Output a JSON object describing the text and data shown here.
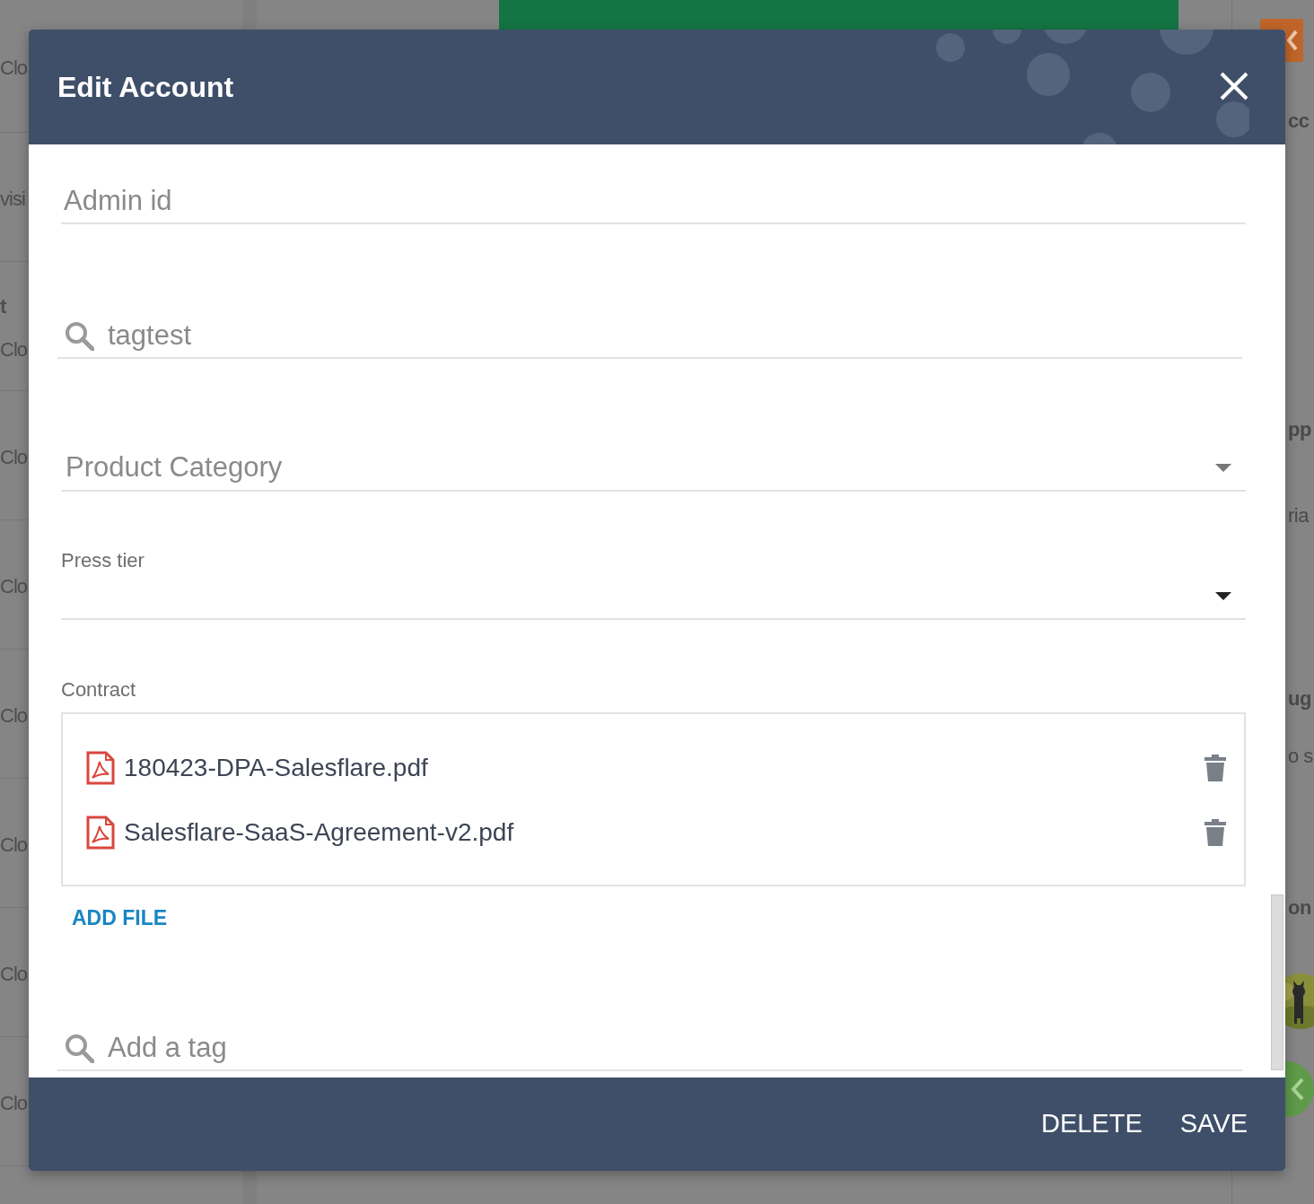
{
  "background": {
    "left_rows": [
      {
        "lines": [
          {
            "text": "Clo",
            "bold": false
          }
        ]
      },
      {
        "lines": [
          {
            "text": "visi",
            "bold": false
          }
        ]
      },
      {
        "lines": [
          {
            "text": "t",
            "bold": true
          },
          {
            "text": "Clo",
            "bold": false
          }
        ]
      },
      {
        "lines": [
          {
            "text": "Clo",
            "bold": false
          }
        ]
      },
      {
        "lines": [
          {
            "text": "Clo",
            "bold": false
          }
        ]
      },
      {
        "lines": [
          {
            "text": "Clo",
            "bold": false
          }
        ]
      },
      {
        "lines": [
          {
            "text": "Clo",
            "bold": false
          }
        ]
      },
      {
        "lines": [
          {
            "text": "Clo",
            "bold": false
          }
        ]
      },
      {
        "lines": [
          {
            "text": "Clo",
            "bold": false
          }
        ]
      }
    ],
    "right_texts": [
      {
        "text": "cc",
        "bold": true
      },
      {
        "text": "pp",
        "bold": true
      },
      {
        "text": "ria",
        "bold": false
      },
      {
        "text": "ug",
        "bold": true
      },
      {
        "text": "o s",
        "bold": false
      },
      {
        "text": "on",
        "bold": true
      }
    ]
  },
  "dialog": {
    "title": "Edit Account",
    "fields": [
      {
        "kind": "text",
        "placeholder": "Admin id"
      },
      {
        "kind": "search",
        "placeholder": "tagtest"
      },
      {
        "kind": "select",
        "placeholder": "Product Category"
      },
      {
        "kind": "select",
        "label": "Press tier"
      },
      {
        "kind": "files",
        "label": "Contract",
        "files": [
          "180423-DPA-Salesflare.pdf",
          "Salesflare-SaaS-Agreement-v2.pdf"
        ],
        "add_label": "ADD FILE"
      },
      {
        "kind": "search",
        "placeholder": "Add a tag"
      }
    ],
    "buttons": [
      "DELETE",
      "SAVE"
    ]
  }
}
